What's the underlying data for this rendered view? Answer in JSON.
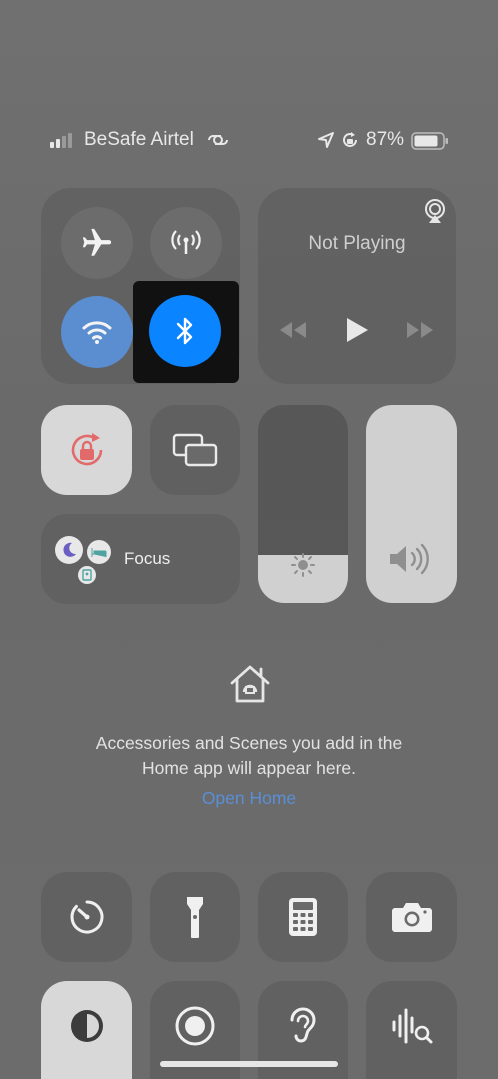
{
  "status": {
    "carrier": "BeSafe Airtel",
    "battery_percent": "87%",
    "signal_bars_active": 2,
    "icons": [
      "cellular-signal-icon",
      "carrier-link-icon",
      "location-arrow-icon",
      "rotation-lock-status-icon",
      "battery-icon"
    ]
  },
  "connectivity": {
    "airplane": {
      "icon": "airplane-icon",
      "on": false
    },
    "cellular": {
      "icon": "antenna-icon",
      "on": false
    },
    "wifi": {
      "icon": "wifi-icon",
      "on": true
    },
    "bluetooth": {
      "icon": "bluetooth-icon",
      "on": true,
      "highlighted": true
    }
  },
  "media": {
    "title": "Not Playing",
    "airplay_icon": "airplay-icon",
    "controls": [
      "rewind-icon",
      "play-icon",
      "fast-forward-icon"
    ]
  },
  "focus": {
    "label": "Focus",
    "icons": [
      "moon-icon",
      "bed-icon",
      "id-badge-icon"
    ]
  },
  "tiles": {
    "rotation_lock": {
      "icon": "rotation-lock-icon",
      "on": true
    },
    "screen_mirroring": {
      "icon": "screen-mirroring-icon"
    }
  },
  "sliders": {
    "brightness": {
      "level": 0.24,
      "icon": "sun-icon"
    },
    "volume": {
      "level": 1.0,
      "icon": "speaker-icon"
    }
  },
  "home": {
    "icon": "home-icon",
    "message": "Accessories and Scenes you add in the Home app will appear here.",
    "message_line1": "Accessories and Scenes you add in the",
    "message_line2": "Home app will appear here.",
    "link": "Open Home"
  },
  "bottom_grid": {
    "row1": [
      "timer-icon",
      "flashlight-icon",
      "calculator-icon",
      "camera-icon"
    ],
    "row2": [
      "dark-mode-icon",
      "screen-record-icon",
      "hearing-icon",
      "sound-recognition-icon"
    ]
  },
  "colors": {
    "bluetooth_blue": "#0A84FF",
    "wifi_blue": "#5a8ed0",
    "highlight_box": "#111111",
    "rotation_red": "#e26a6a",
    "link_blue": "#5a8fd6"
  }
}
